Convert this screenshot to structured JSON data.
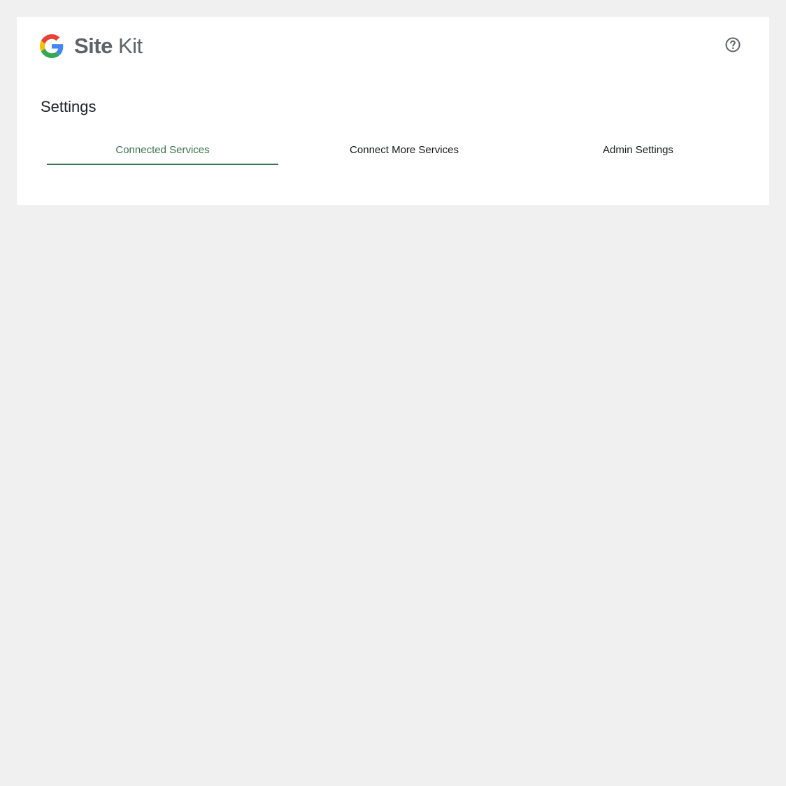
{
  "app": {
    "brand_bold": "Site",
    "brand_light": "Kit"
  },
  "icons": {
    "logo": "google-g-icon",
    "help": "help-circle-icon"
  },
  "colors": {
    "background": "#f0f0f0",
    "card": "#ffffff",
    "accent": "#3c7251",
    "text": "#161b18"
  },
  "page": {
    "title": "Settings"
  },
  "tabs": [
    {
      "label": "Connected Services",
      "active": true
    },
    {
      "label": "Connect More Services",
      "active": false
    },
    {
      "label": "Admin Settings",
      "active": false
    }
  ]
}
